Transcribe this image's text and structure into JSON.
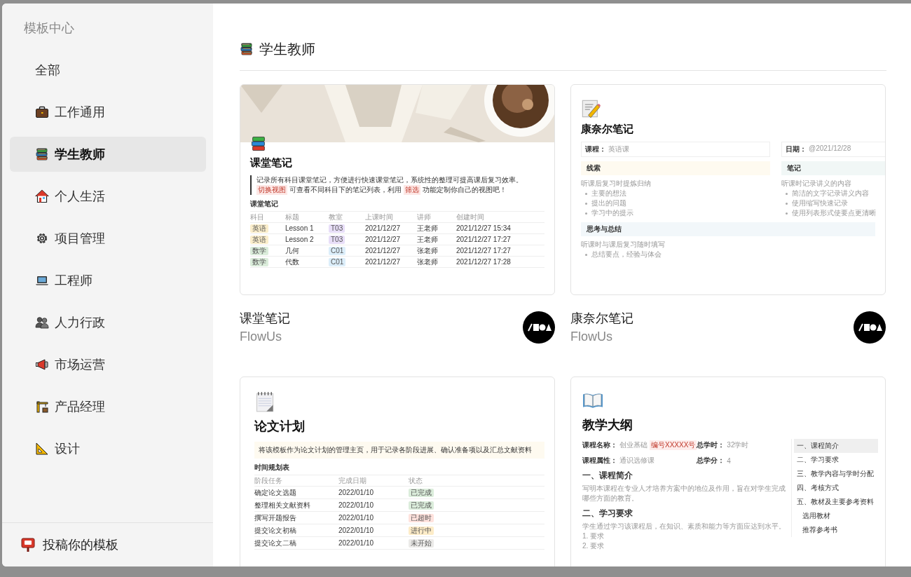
{
  "sidebar": {
    "title": "模板中心",
    "items": [
      {
        "label": "全部",
        "selected": false
      },
      {
        "label": "工作通用",
        "selected": false
      },
      {
        "label": "学生教师",
        "selected": true
      },
      {
        "label": "个人生活",
        "selected": false
      },
      {
        "label": "项目管理",
        "selected": false
      },
      {
        "label": "工程师",
        "selected": false
      },
      {
        "label": "人力行政",
        "selected": false
      },
      {
        "label": "市场运营",
        "selected": false
      },
      {
        "label": "产品经理",
        "selected": false
      },
      {
        "label": "设计",
        "selected": false
      }
    ],
    "footer": {
      "label": "投稿你的模板"
    }
  },
  "section": {
    "title": "学生教师"
  },
  "templates": [
    {
      "name": "课堂笔记",
      "author": "FlowUs",
      "preview": {
        "kind": "course-notes",
        "title": "课堂笔记",
        "quote": [
          [
            {
              "kind": "text",
              "text": "记录所有科目课堂笔记，方便进行快速课堂笔记，系统性的整理可提高课后复习效率。"
            }
          ],
          [
            {
              "kind": "tag",
              "text": "切换视图"
            },
            {
              "kind": "text",
              "text": "可查看不同科目下的笔记列表，利用"
            },
            {
              "kind": "tag",
              "text": "筛选"
            },
            {
              "kind": "text",
              "text": "功能定制你自己的视图吧！"
            }
          ]
        ],
        "table_title": "课堂笔记",
        "columns": [
          "科目",
          "标题",
          "教室",
          "上课时间",
          "讲师",
          "创建时间"
        ],
        "rows": [
          [
            {
              "text": "英语",
              "color": "#fbeecb"
            },
            {
              "text": "Lesson 1"
            },
            {
              "text": "T03",
              "color": "#e8def8"
            },
            {
              "text": "2021/12/27"
            },
            {
              "text": "王老师"
            },
            {
              "text": "2021/12/27 15:34"
            }
          ],
          [
            {
              "text": "英语",
              "color": "#fbeecb"
            },
            {
              "text": "Lesson 2"
            },
            {
              "text": "T03",
              "color": "#e8def8"
            },
            {
              "text": "2021/12/27"
            },
            {
              "text": "王老师"
            },
            {
              "text": "2021/12/27 17:27"
            }
          ],
          [
            {
              "text": "数学",
              "color": "#dbeddb"
            },
            {
              "text": "几何"
            },
            {
              "text": "C01",
              "color": "#dceefa"
            },
            {
              "text": "2021/12/27"
            },
            {
              "text": "张老师"
            },
            {
              "text": "2021/12/27 17:27"
            }
          ],
          [
            {
              "text": "数学",
              "color": "#dbeddb"
            },
            {
              "text": "代数"
            },
            {
              "text": "C01",
              "color": "#dceefa"
            },
            {
              "text": "2021/12/27"
            },
            {
              "text": "张老师"
            },
            {
              "text": "2021/12/27 17:28"
            }
          ]
        ]
      }
    },
    {
      "name": "康奈尔笔记",
      "author": "FlowUs",
      "preview": {
        "kind": "cornell",
        "title": "康奈尔笔记",
        "columns": [
          {
            "field_label": "课程：",
            "field_value": "英语课",
            "heading": "线索",
            "desc": "听课后复习时提炼归纳",
            "bullets": [
              "主要的想法",
              "提出的问题",
              "学习中的提示"
            ]
          },
          {
            "field_label": "日期：",
            "field_value": "@2021/12/28",
            "heading": "笔记",
            "desc": "听课时记录讲义的内容",
            "bullets": [
              "简洁的文字记录讲义内容",
              "使用缩写快速记录",
              "使用列表形式使要点更清晰"
            ]
          }
        ],
        "summary": {
          "heading": "思考与总结",
          "desc": "听课时与课后复习随时填写",
          "bullets": [
            "总结要点，经验与体会"
          ]
        }
      }
    },
    {
      "preview": {
        "kind": "plan",
        "title": "论文计划",
        "callout": "将该模板作为论文计划的管理主页，用于记录各阶段进展、确认准备项以及汇总文献资料",
        "table_title": "时间规划表",
        "columns": [
          "阶段任务",
          "完成日期",
          "状态"
        ],
        "rows": [
          {
            "task": "确定论文选题",
            "date": "2022/01/10",
            "status": "已完成",
            "color": "#dbeddb"
          },
          {
            "task": "整理相关文献资料",
            "date": "2022/01/10",
            "status": "已完成",
            "color": "#dbeddb"
          },
          {
            "task": "撰写开题报告",
            "date": "2022/01/10",
            "status": "已超时",
            "color": "#ffe2dd"
          },
          {
            "task": "提交论文初稿",
            "date": "2022/01/10",
            "status": "进行中",
            "color": "#fdecc8"
          },
          {
            "task": "提交论文二稿",
            "date": "2022/01/10",
            "status": "未开始",
            "color": "#ebeae8"
          }
        ]
      }
    },
    {
      "preview": {
        "kind": "syllabus",
        "title": "教学大纲",
        "props": [
          {
            "label": "课程名称：",
            "value": "创业基础",
            "tag": "编号XXXXX号"
          },
          {
            "label": "总学时：",
            "value": "32学时"
          },
          {
            "label": "课程属性：",
            "value": "通识选修课"
          },
          {
            "label": "总学分：",
            "value": "4"
          }
        ],
        "sections": [
          {
            "heading": "一、课程简介",
            "text": "写明本课程在专业人才培养方案中的地位及作用，旨在对学生完成哪些方面的教育。"
          },
          {
            "heading": "二、学习要求",
            "text": "学生通过学习该课程后，在知识、素质和能力等方面应达到水平。",
            "items": [
              "1.  要求",
              "2.  要求"
            ]
          }
        ],
        "toc": [
          {
            "label": "一、课程简介",
            "selected": true
          },
          {
            "label": "二、学习要求",
            "selected": false
          },
          {
            "label": "三、教学内容与学时分配",
            "selected": false
          },
          {
            "label": "四、考核方式",
            "selected": false
          },
          {
            "label": "五、教材及主要参考资料",
            "selected": false,
            "children": [
              {
                "label": "选用教材",
                "selected": false
              },
              {
                "label": "推荐参考书",
                "selected": false
              }
            ]
          }
        ]
      }
    }
  ]
}
